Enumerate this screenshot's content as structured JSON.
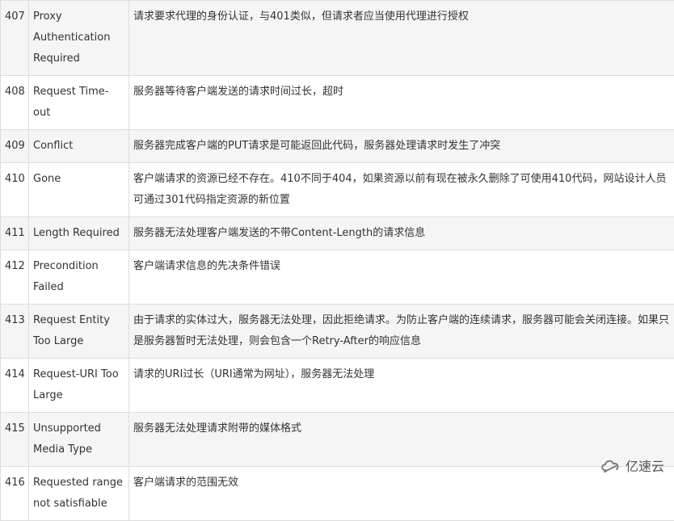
{
  "rows": [
    {
      "code": "407",
      "name": "Proxy Authentication Required",
      "desc": "请求要求代理的身份认证，与401类似，但请求者应当使用代理进行授权"
    },
    {
      "code": "408",
      "name": "Request Time-out",
      "desc": "服务器等待客户端发送的请求时间过长，超时"
    },
    {
      "code": "409",
      "name": "Conflict",
      "desc": "服务器完成客户端的PUT请求是可能返回此代码，服务器处理请求时发生了冲突"
    },
    {
      "code": "410",
      "name": "Gone",
      "desc": "客户端请求的资源已经不存在。410不同于404，如果资源以前有现在被永久删除了可使用410代码，网站设计人员可通过301代码指定资源的新位置"
    },
    {
      "code": "411",
      "name": "Length Required",
      "desc": "服务器无法处理客户端发送的不带Content-Length的请求信息"
    },
    {
      "code": "412",
      "name": "Precondition Failed",
      "desc": "客户端请求信息的先决条件错误"
    },
    {
      "code": "413",
      "name": "Request Entity Too Large",
      "desc": "由于请求的实体过大，服务器无法处理，因此拒绝请求。为防止客户端的连续请求，服务器可能会关闭连接。如果只是服务器暂时无法处理，则会包含一个Retry-After的响应信息"
    },
    {
      "code": "414",
      "name": "Request-URI Too Large",
      "desc": "请求的URI过长（URI通常为网址），服务器无法处理"
    },
    {
      "code": "415",
      "name": "Unsupported Media Type",
      "desc": "服务器无法处理请求附带的媒体格式"
    },
    {
      "code": "416",
      "name": "Requested range not satisfiable",
      "desc": "客户端请求的范围无效"
    }
  ],
  "watermark": {
    "text": "亿速云",
    "icon": "cloud-logo-icon"
  }
}
